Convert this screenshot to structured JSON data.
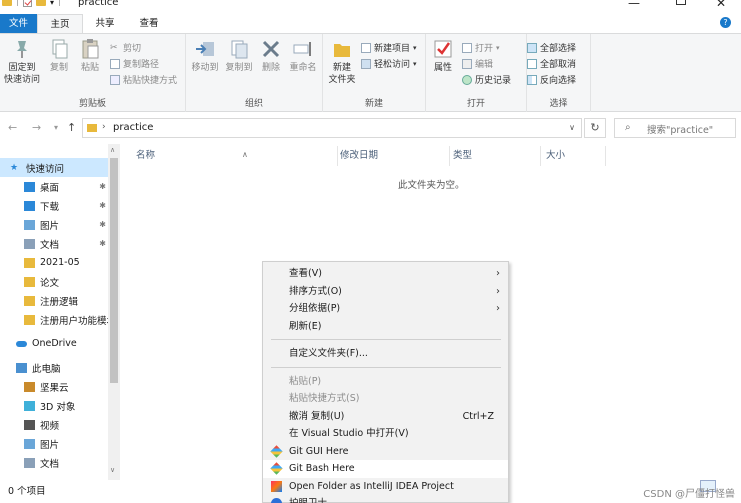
{
  "window": {
    "title": "practice"
  },
  "ribbon_tabs": [
    "文件",
    "主页",
    "共享",
    "查看"
  ],
  "ribbon": {
    "clipboard": {
      "label": "剪贴板",
      "pin_quick_access": "固定到\n快速访问",
      "copy": "复制",
      "paste": "粘贴",
      "cut": "剪切",
      "copy_path": "复制路径",
      "paste_shortcut": "粘贴快捷方式"
    },
    "organize": {
      "label": "组织",
      "move_to": "移动到",
      "copy_to": "复制到",
      "delete": "删除",
      "rename": "重命名"
    },
    "new": {
      "label": "新建",
      "new_folder": "新建\n文件夹",
      "new_item": "新建项目",
      "easy_access": "轻松访问"
    },
    "open": {
      "label": "打开",
      "properties": "属性",
      "open": "打开",
      "edit": "编辑",
      "history": "历史记录"
    },
    "select": {
      "label": "选择",
      "select_all": "全部选择",
      "select_none": "全部取消",
      "invert": "反向选择"
    }
  },
  "address": {
    "path": "practice",
    "search_placeholder": "搜索\"practice\""
  },
  "nav_pane": [
    {
      "label": "快速访问",
      "icon": "star-icon",
      "selected": true
    },
    {
      "label": "桌面",
      "icon": "desktop-icon",
      "pinned": true
    },
    {
      "label": "下载",
      "icon": "download-icon",
      "pinned": true
    },
    {
      "label": "图片",
      "icon": "pictures-icon",
      "pinned": true
    },
    {
      "label": "文档",
      "icon": "documents-icon",
      "pinned": true
    },
    {
      "label": "2021-05",
      "icon": "folder-icon"
    },
    {
      "label": "论文",
      "icon": "folder-icon"
    },
    {
      "label": "注册逻辑",
      "icon": "folder-icon"
    },
    {
      "label": "注册用户功能模块",
      "icon": "folder-icon"
    },
    {
      "label": "OneDrive",
      "icon": "cloud-icon"
    },
    {
      "label": "此电脑",
      "icon": "computer-icon"
    },
    {
      "label": "坚果云",
      "icon": "nut-icon"
    },
    {
      "label": "3D 对象",
      "icon": "3d-icon"
    },
    {
      "label": "视频",
      "icon": "video-icon"
    },
    {
      "label": "图片",
      "icon": "pictures-icon"
    },
    {
      "label": "文档",
      "icon": "documents-icon"
    }
  ],
  "columns": [
    "名称",
    "修改日期",
    "类型",
    "大小"
  ],
  "empty_message": "此文件夹为空。",
  "status": {
    "item_count": "0 个项目",
    "watermark": "CSDN @尸僵打怪兽"
  },
  "context_menu": [
    {
      "label": "查看(V)",
      "submenu": true
    },
    {
      "label": "排序方式(O)",
      "submenu": true
    },
    {
      "label": "分组依据(P)",
      "submenu": true
    },
    {
      "label": "刷新(E)"
    },
    {
      "separator": true
    },
    {
      "label": "自定义文件夹(F)..."
    },
    {
      "separator": true
    },
    {
      "label": "粘贴(P)",
      "disabled": true
    },
    {
      "label": "粘贴快捷方式(S)",
      "disabled": true
    },
    {
      "label": "撤消 复制(U)",
      "shortcut": "Ctrl+Z"
    },
    {
      "label": "在 Visual Studio 中打开(V)"
    },
    {
      "label": "Git GUI Here",
      "icon": "git-gui-icon"
    },
    {
      "label": "Git Bash Here",
      "icon": "git-bash-icon",
      "hover": true
    },
    {
      "label": "Open Folder as IntelliJ IDEA Project",
      "icon": "intellij-icon"
    },
    {
      "label": "护眼卫士",
      "icon": "eye-guard-icon"
    }
  ],
  "colors": {
    "accent": "#1979ca",
    "selection": "#cce8ff",
    "folder": "#e8b93c"
  }
}
